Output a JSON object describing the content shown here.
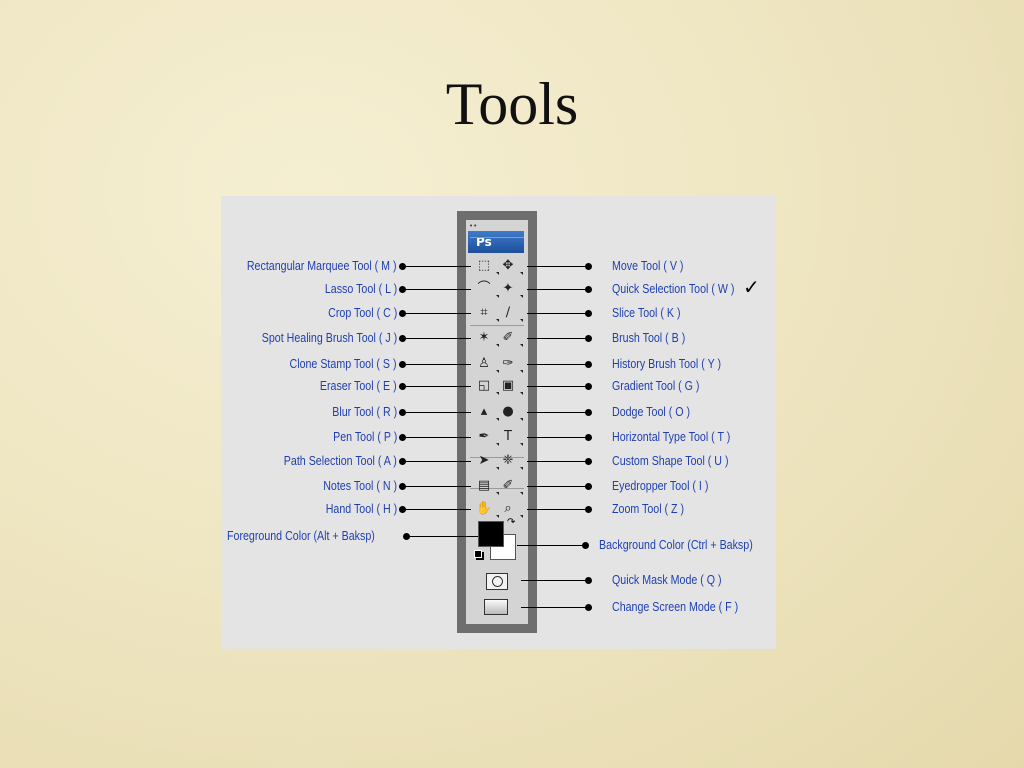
{
  "slide": {
    "title": "Tools"
  },
  "toolbox": {
    "logo": "Ps",
    "grip": "••",
    "left_labels": [
      "Rectangular Marquee Tool ( M )",
      "Lasso Tool ( L )",
      "Crop Tool ( C )",
      "Spot Healing Brush Tool ( J )",
      "Clone Stamp Tool ( S )",
      "Eraser Tool ( E )",
      "Blur Tool ( R )",
      "Pen Tool ( P )",
      "Path Selection Tool ( A )",
      "Notes Tool ( N )",
      "Hand Tool ( H )",
      "Foreground Color (Alt + Baksp)"
    ],
    "right_labels": [
      "Move Tool ( V )",
      "Quick Selection Tool ( W )",
      "Slice Tool ( K )",
      "Brush Tool ( B )",
      "History Brush Tool ( Y )",
      "Gradient Tool ( G )",
      "Dodge Tool ( O )",
      "Horizontal Type Tool ( T )",
      "Custom Shape Tool ( U )",
      "Eyedropper Tool ( I )",
      "Zoom Tool ( Z )",
      "Background Color (Ctrl + Baksp)",
      "Quick Mask Mode ( Q )",
      "Change Screen Mode ( F )"
    ],
    "left_icons": [
      "marquee-icon",
      "lasso-icon",
      "crop-icon",
      "healing-brush-icon",
      "clone-stamp-icon",
      "eraser-icon",
      "blur-icon",
      "pen-icon",
      "path-selection-icon",
      "notes-icon",
      "hand-icon"
    ],
    "right_icons": [
      "move-icon",
      "quick-selection-icon",
      "slice-icon",
      "brush-icon",
      "history-brush-icon",
      "gradient-icon",
      "dodge-icon",
      "type-icon",
      "custom-shape-icon",
      "eyedropper-icon",
      "zoom-icon"
    ],
    "left_glyphs": [
      "⬚",
      "⌒",
      "⌗",
      "✶",
      "♙",
      "◱",
      "▴",
      "✒",
      "➤",
      "▤",
      "✋"
    ],
    "right_glyphs": [
      "✥",
      "✦",
      "∕",
      "✐",
      "✑",
      "▣",
      "●",
      "T",
      "❈",
      "✐",
      "⌕"
    ],
    "check_mark": "✓",
    "label_color": "#1f3fb0"
  }
}
